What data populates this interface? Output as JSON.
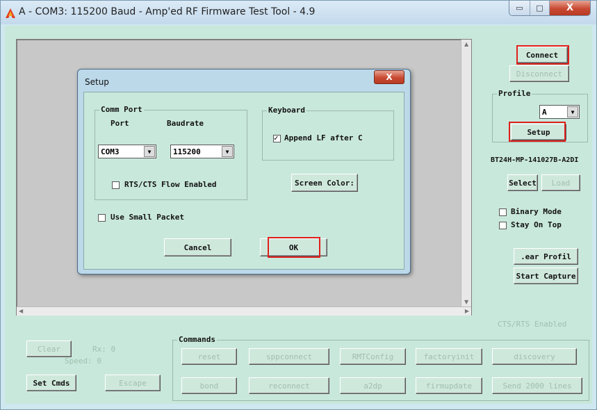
{
  "window": {
    "title": "A - COM3: 115200 Baud - Amp'ed RF Firmware Test Tool - 4.9",
    "btn_min": "▭",
    "btn_max": "□",
    "btn_close": "X"
  },
  "right_panel": {
    "connect": "Connect",
    "disconnect": "Disconnect",
    "profile_title": "Profile",
    "profile_value": "A",
    "setup": "Setup",
    "device_name": "BT24H-MP-141027B-A2DI",
    "select": "Select",
    "load": "Load",
    "binary_mode": "Binary Mode",
    "stay_on_top": "Stay On Top",
    "clear_profile": ".ear Profil",
    "start_capture": "Start Capture",
    "cts_status": "CTS/RTS Enabled"
  },
  "bottom": {
    "clear": "Clear",
    "rx": "Rx: 0",
    "speed": "Speed: 0",
    "set_cmds": "Set Cmds",
    "escape": "Escape",
    "commands_title": "Commands",
    "commands": [
      "reset",
      "sppconnect",
      "RMTConfig",
      "factoryinit",
      "discovery",
      "bond",
      "reconnect",
      "a2dp",
      "firmupdate",
      "Send 2000 lines"
    ]
  },
  "dialog": {
    "title": "Setup",
    "close": "X",
    "comm_port_title": "Comm Port",
    "port_label": "Port",
    "baudrate_label": "Baudrate",
    "port_value": "COM3",
    "baud_value": "115200",
    "rts_cts": "RTS/CTS Flow Enabled",
    "keyboard_title": "Keyboard",
    "append_lf": "Append LF after C",
    "screen_color": "Screen Color:",
    "use_small_packet": "Use Small Packet",
    "cancel": "Cancel",
    "ok": "OK"
  },
  "colors": {
    "background": "#c9e8dc",
    "highlight": "#e0201b",
    "disabled_text": "#9fbfae",
    "terminal": "#c8c8c8"
  }
}
